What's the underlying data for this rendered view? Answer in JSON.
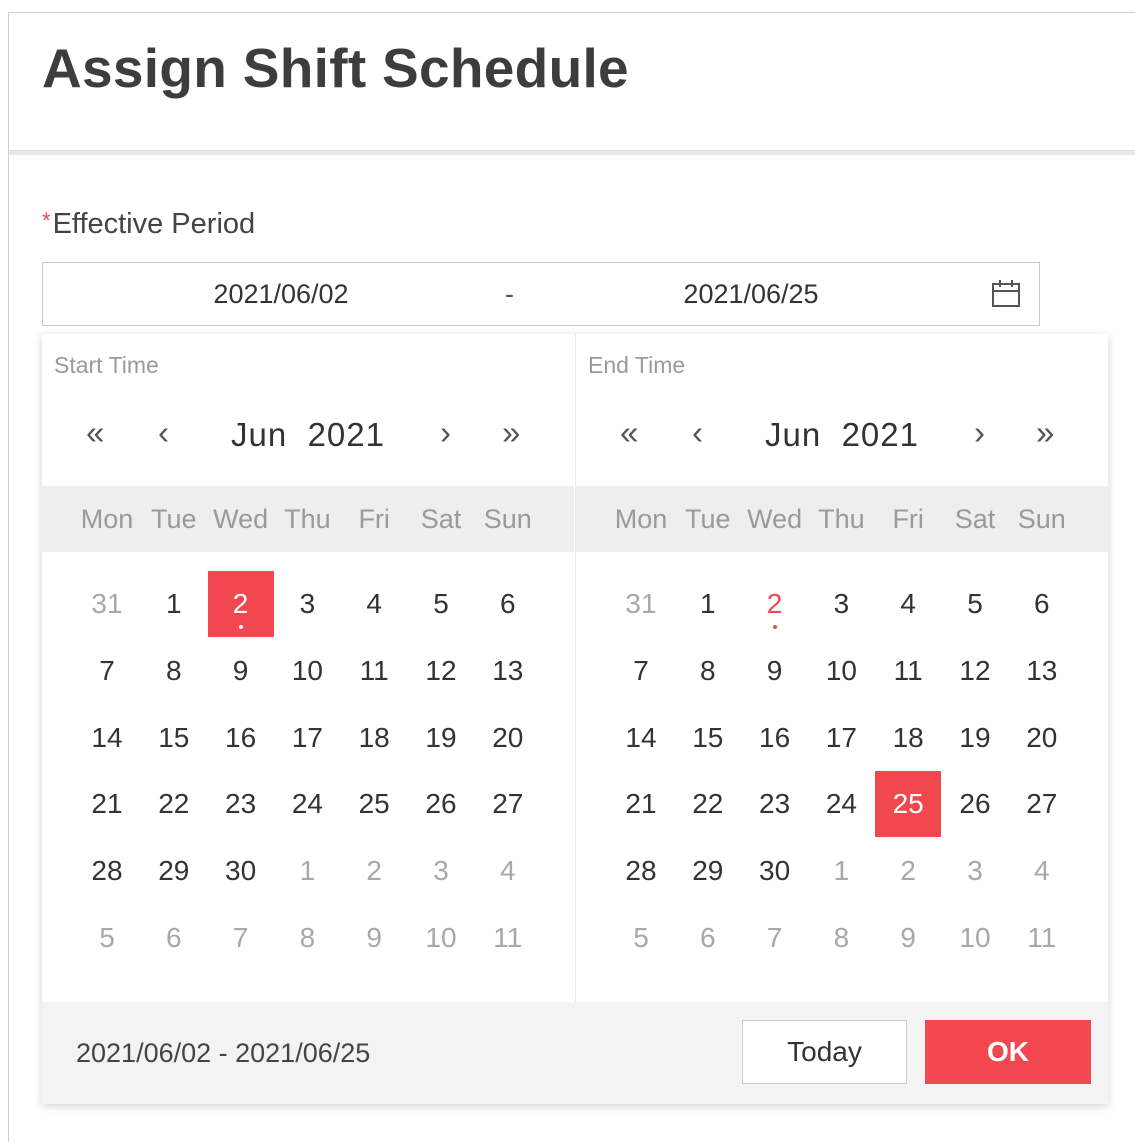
{
  "header": {
    "title": "Assign Shift Schedule"
  },
  "form": {
    "required_mark": "*",
    "effective_label": "Effective Period",
    "start_value": "2021/06/02",
    "separator": "-",
    "end_value": "2021/06/25",
    "icon": "calendar-icon"
  },
  "picker": {
    "weekdays": [
      "Mon",
      "Tue",
      "Wed",
      "Thu",
      "Fri",
      "Sat",
      "Sun"
    ],
    "nav": {
      "prev_year": "«",
      "prev_month": "‹",
      "next_month": "›",
      "next_year": "»"
    },
    "panels": [
      {
        "label": "Start Time",
        "month": "Jun",
        "year": "2021",
        "days": [
          [
            {
              "d": "31",
              "other": true
            },
            {
              "d": "1"
            },
            {
              "d": "2",
              "selected": true,
              "today": true
            },
            {
              "d": "3"
            },
            {
              "d": "4"
            },
            {
              "d": "5"
            },
            {
              "d": "6"
            }
          ],
          [
            {
              "d": "7"
            },
            {
              "d": "8"
            },
            {
              "d": "9"
            },
            {
              "d": "10"
            },
            {
              "d": "11"
            },
            {
              "d": "12"
            },
            {
              "d": "13"
            }
          ],
          [
            {
              "d": "14"
            },
            {
              "d": "15"
            },
            {
              "d": "16"
            },
            {
              "d": "17"
            },
            {
              "d": "18"
            },
            {
              "d": "19"
            },
            {
              "d": "20"
            }
          ],
          [
            {
              "d": "21"
            },
            {
              "d": "22"
            },
            {
              "d": "23"
            },
            {
              "d": "24"
            },
            {
              "d": "25"
            },
            {
              "d": "26"
            },
            {
              "d": "27"
            }
          ],
          [
            {
              "d": "28"
            },
            {
              "d": "29"
            },
            {
              "d": "30"
            },
            {
              "d": "1",
              "other": true
            },
            {
              "d": "2",
              "other": true
            },
            {
              "d": "3",
              "other": true
            },
            {
              "d": "4",
              "other": true
            }
          ],
          [
            {
              "d": "5",
              "other": true
            },
            {
              "d": "6",
              "other": true
            },
            {
              "d": "7",
              "other": true
            },
            {
              "d": "8",
              "other": true
            },
            {
              "d": "9",
              "other": true
            },
            {
              "d": "10",
              "other": true
            },
            {
              "d": "11",
              "other": true
            }
          ]
        ]
      },
      {
        "label": "End Time",
        "month": "Jun",
        "year": "2021",
        "days": [
          [
            {
              "d": "31",
              "other": true
            },
            {
              "d": "1"
            },
            {
              "d": "2",
              "today": true
            },
            {
              "d": "3"
            },
            {
              "d": "4"
            },
            {
              "d": "5"
            },
            {
              "d": "6"
            }
          ],
          [
            {
              "d": "7"
            },
            {
              "d": "8"
            },
            {
              "d": "9"
            },
            {
              "d": "10"
            },
            {
              "d": "11"
            },
            {
              "d": "12"
            },
            {
              "d": "13"
            }
          ],
          [
            {
              "d": "14"
            },
            {
              "d": "15"
            },
            {
              "d": "16"
            },
            {
              "d": "17"
            },
            {
              "d": "18"
            },
            {
              "d": "19"
            },
            {
              "d": "20"
            }
          ],
          [
            {
              "d": "21"
            },
            {
              "d": "22"
            },
            {
              "d": "23"
            },
            {
              "d": "24"
            },
            {
              "d": "25",
              "selected": true
            },
            {
              "d": "26"
            },
            {
              "d": "27"
            }
          ],
          [
            {
              "d": "28"
            },
            {
              "d": "29"
            },
            {
              "d": "30"
            },
            {
              "d": "1",
              "other": true
            },
            {
              "d": "2",
              "other": true
            },
            {
              "d": "3",
              "other": true
            },
            {
              "d": "4",
              "other": true
            }
          ],
          [
            {
              "d": "5",
              "other": true
            },
            {
              "d": "6",
              "other": true
            },
            {
              "d": "7",
              "other": true
            },
            {
              "d": "8",
              "other": true
            },
            {
              "d": "9",
              "other": true
            },
            {
              "d": "10",
              "other": true
            },
            {
              "d": "11",
              "other": true
            }
          ]
        ]
      }
    ],
    "footer": {
      "range_text": "2021/06/02 - 2021/06/25",
      "today_label": "Today",
      "ok_label": "OK"
    }
  },
  "colors": {
    "accent": "#f0484e",
    "muted": "#a8a8a8",
    "header_band": "#eeeeee"
  }
}
